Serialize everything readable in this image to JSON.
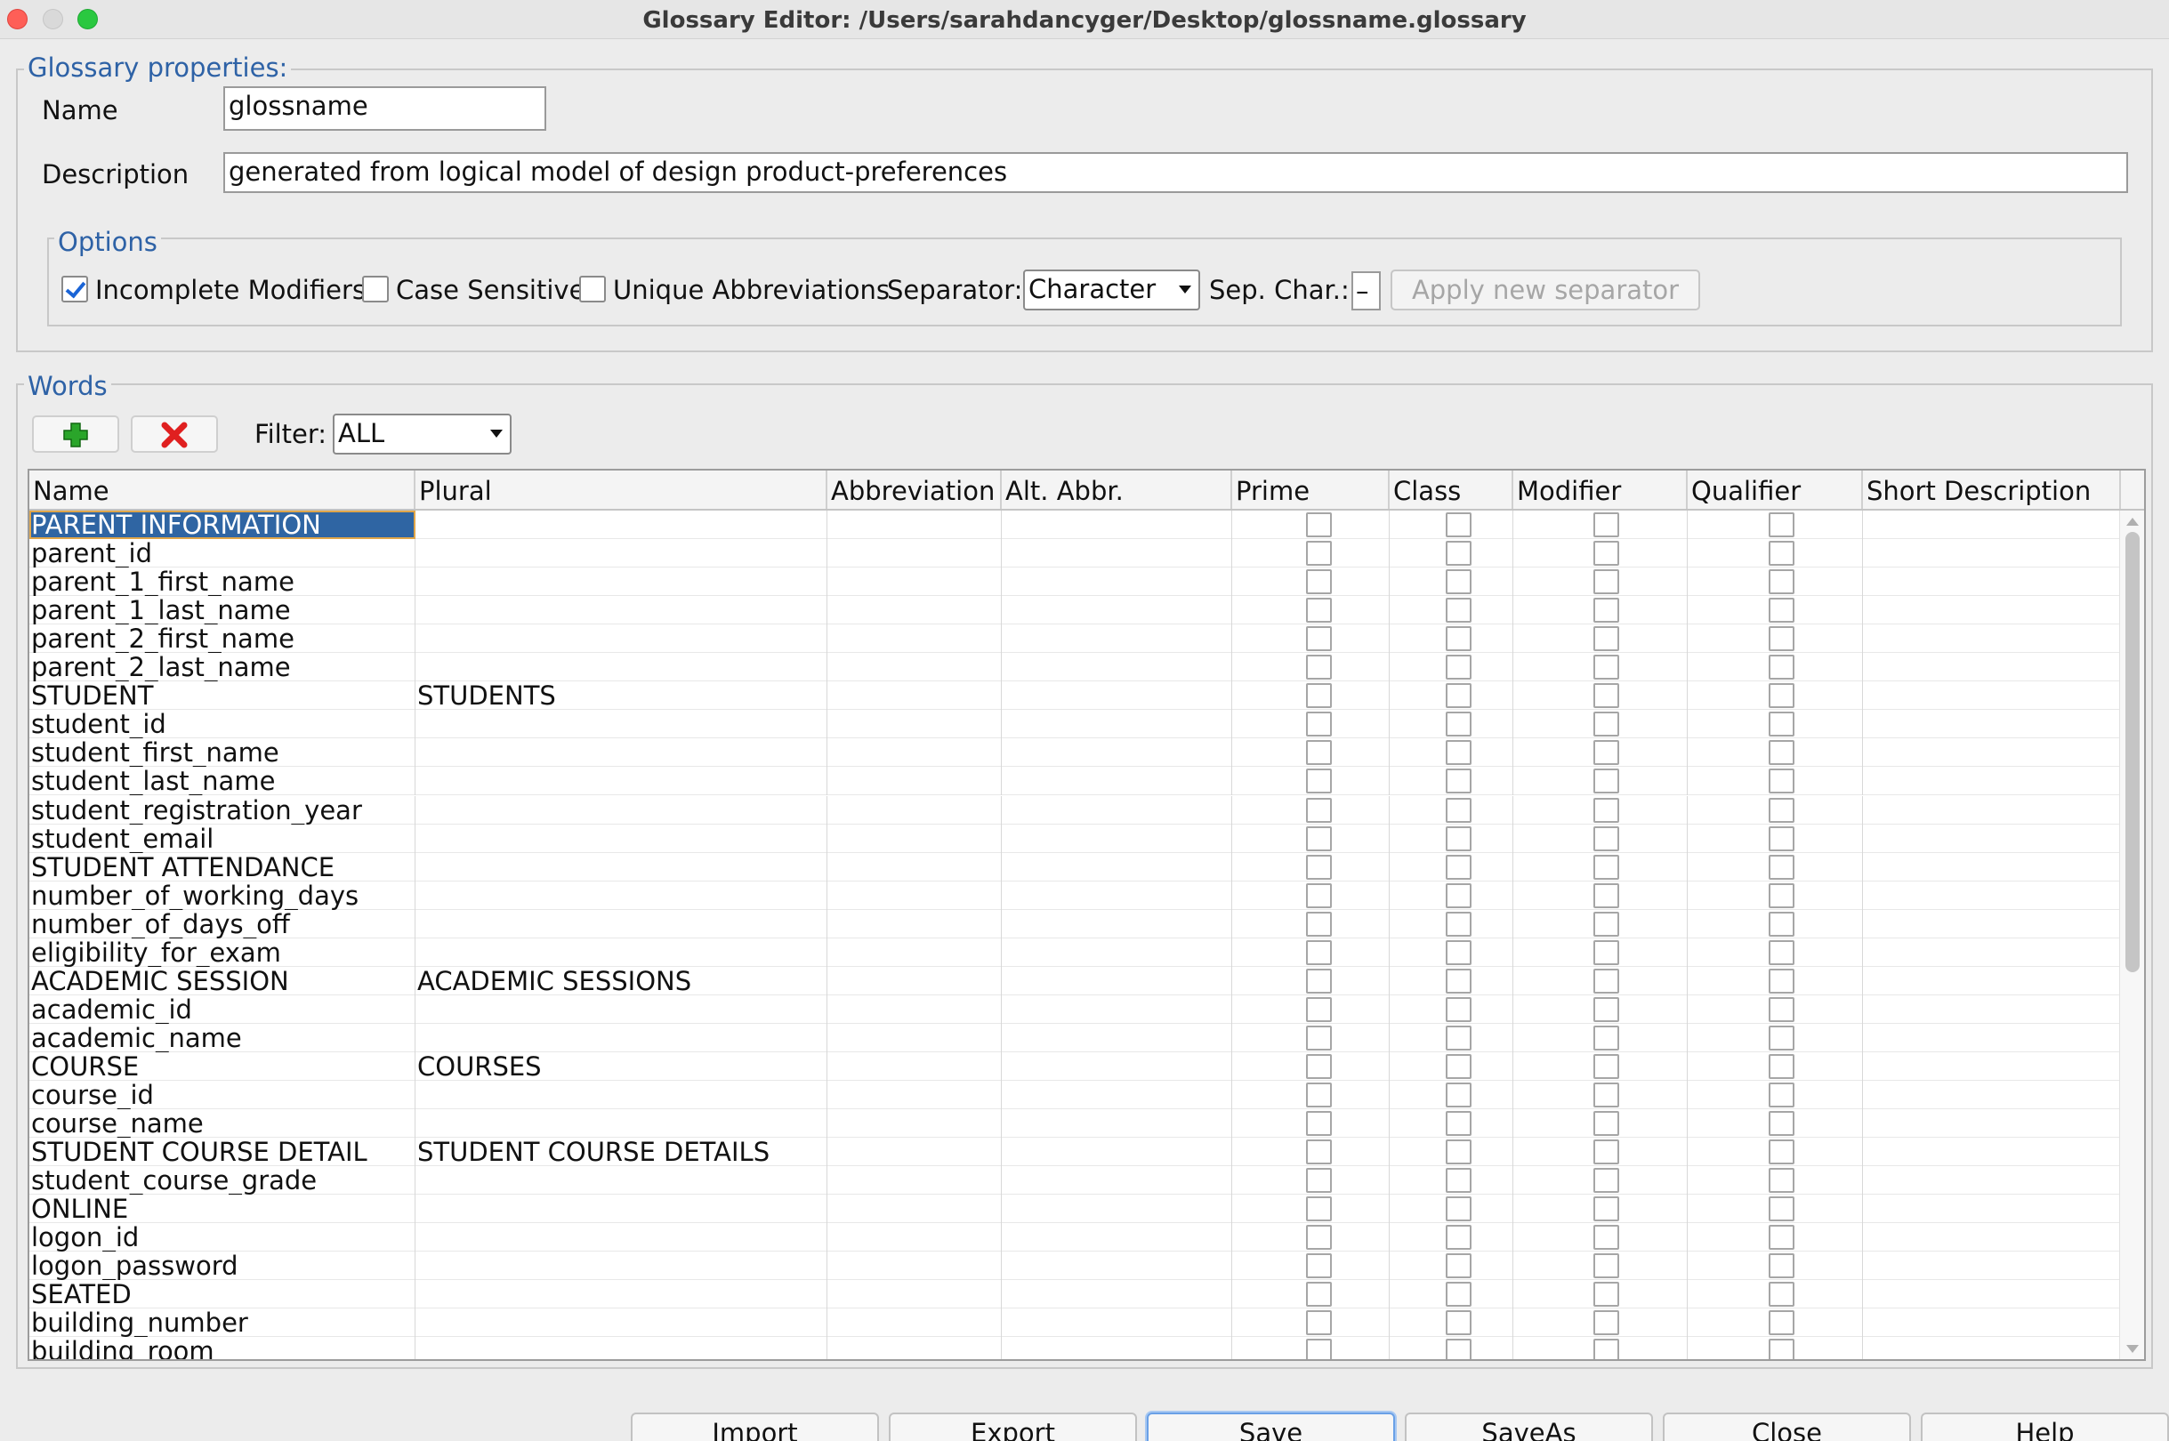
{
  "window": {
    "title": "Glossary Editor: /Users/sarahdancyger/Desktop/glossname.glossary"
  },
  "properties": {
    "legend": "Glossary properties:",
    "name_label": "Name",
    "name_value": "glossname",
    "description_label": "Description",
    "description_value": "generated from logical model of design product-preferences"
  },
  "options": {
    "legend": "Options",
    "incomplete_modifiers_label": "Incomplete Modifiers",
    "incomplete_modifiers_checked": true,
    "case_sensitive_label": "Case Sensitive",
    "case_sensitive_checked": false,
    "unique_abbreviations_label": "Unique Abbreviations",
    "unique_abbreviations_checked": false,
    "separator_label": "Separator:",
    "separator_value": "Character",
    "sep_char_label": "Sep. Char.:",
    "sep_char_value": "–",
    "apply_button_label": "Apply new separator"
  },
  "words": {
    "legend": "Words",
    "add_icon": "plus-icon",
    "remove_icon": "x-icon",
    "filter_label": "Filter:",
    "filter_value": "ALL",
    "columns": [
      "Name",
      "Plural",
      "Abbreviation",
      "Alt. Abbr.",
      "Prime",
      "Class",
      "Modifier",
      "Qualifier",
      "Short Description"
    ],
    "rows": [
      {
        "name": "PARENT INFORMATION",
        "plural": ""
      },
      {
        "name": "parent_id",
        "plural": ""
      },
      {
        "name": "parent_1_first_name",
        "plural": ""
      },
      {
        "name": "parent_1_last_name",
        "plural": ""
      },
      {
        "name": "parent_2_first_name",
        "plural": ""
      },
      {
        "name": "parent_2_last_name",
        "plural": ""
      },
      {
        "name": "STUDENT",
        "plural": "STUDENTS"
      },
      {
        "name": "student_id",
        "plural": ""
      },
      {
        "name": "student_first_name",
        "plural": ""
      },
      {
        "name": "student_last_name",
        "plural": ""
      },
      {
        "name": "student_registration_year",
        "plural": ""
      },
      {
        "name": "student_email",
        "plural": ""
      },
      {
        "name": "STUDENT ATTENDANCE",
        "plural": ""
      },
      {
        "name": "number_of_working_days",
        "plural": ""
      },
      {
        "name": "number_of_days_off",
        "plural": ""
      },
      {
        "name": "eligibility_for_exam",
        "plural": ""
      },
      {
        "name": "ACADEMIC SESSION",
        "plural": "ACADEMIC SESSIONS"
      },
      {
        "name": "academic_id",
        "plural": ""
      },
      {
        "name": "academic_name",
        "plural": ""
      },
      {
        "name": "COURSE",
        "plural": "COURSES"
      },
      {
        "name": "course_id",
        "plural": ""
      },
      {
        "name": "course_name",
        "plural": ""
      },
      {
        "name": "STUDENT COURSE DETAIL",
        "plural": "STUDENT COURSE DETAILS"
      },
      {
        "name": "student_course_grade",
        "plural": ""
      },
      {
        "name": "ONLINE",
        "plural": ""
      },
      {
        "name": "logon_id",
        "plural": ""
      },
      {
        "name": "logon_password",
        "plural": ""
      },
      {
        "name": "SEATED",
        "plural": ""
      },
      {
        "name": "building_number",
        "plural": ""
      },
      {
        "name": "building_room",
        "plural": ""
      }
    ]
  },
  "buttons": {
    "import": "Import",
    "export": "Export",
    "save": "Save",
    "saveas": "SaveAs",
    "close": "Close",
    "help": "Help"
  },
  "colors": {
    "legend_text": "#2e62a6",
    "selection": "#2f65a3",
    "add_icon": "#2aa52a",
    "remove_icon": "#e02020"
  }
}
